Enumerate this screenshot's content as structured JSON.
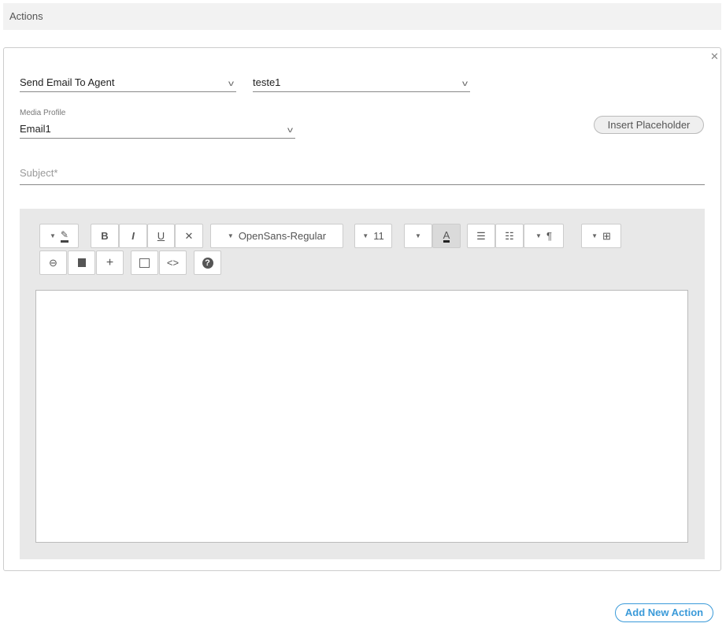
{
  "header": {
    "title": "Actions"
  },
  "action": {
    "type_value": "Send Email To Agent",
    "target_value": "teste1",
    "media_profile_label": "Media Profile",
    "media_profile_value": "Email1",
    "insert_placeholder_label": "Insert Placeholder",
    "subject_placeholder": "Subject*"
  },
  "toolbar": {
    "bold": "B",
    "italic": "I",
    "underline": "U",
    "clear": "✕",
    "font_name": "OpenSans-Regular",
    "font_size": "11",
    "color_letter": "A",
    "paragraph": "¶",
    "table": "⊞",
    "link": "⊖",
    "plus": "+",
    "code": "<>",
    "help": "?"
  },
  "footer": {
    "add_action_label": "Add New Action"
  },
  "colors": {
    "accent": "#3a9ad9"
  }
}
